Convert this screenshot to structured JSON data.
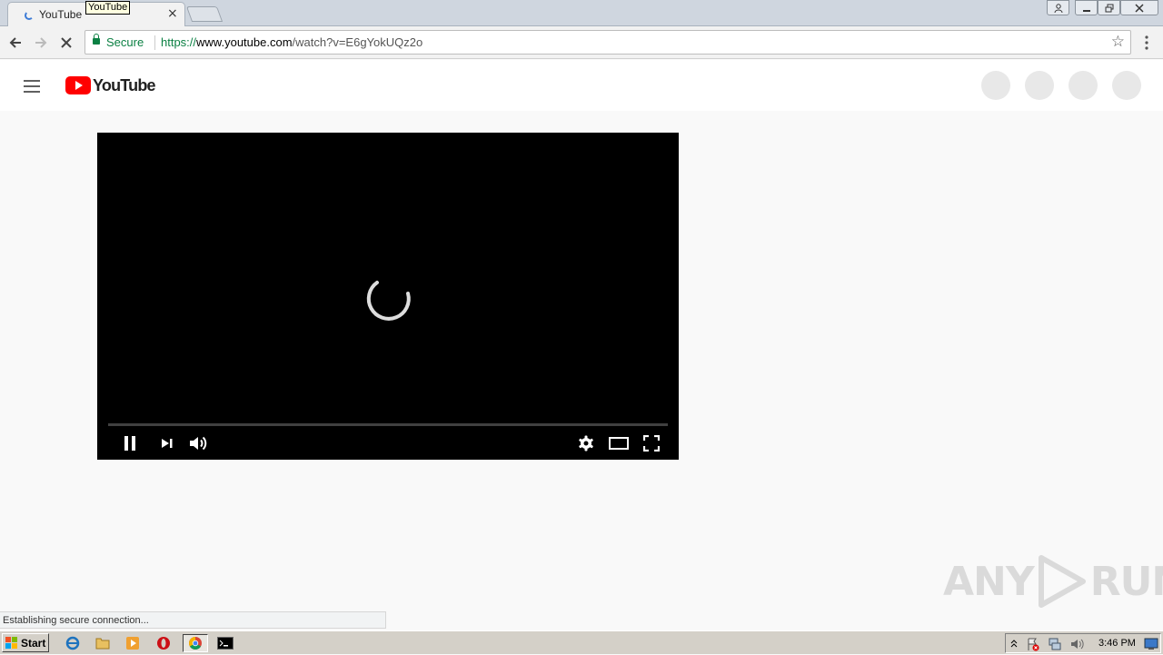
{
  "browser": {
    "tab_title": "YouTube",
    "tooltip": "YouTube",
    "tab_close": "×",
    "secure_label": "Secure",
    "url": {
      "scheme": "https://",
      "host": "www.youtube.com",
      "path": "/watch?v=E6gYokUQz2o"
    },
    "status_text": "Establishing secure connection..."
  },
  "youtube": {
    "logo_text": "YouTube",
    "brand_color": "#ff0000"
  },
  "player": {
    "state": "loading",
    "progress_fraction": 0.0
  },
  "taskbar": {
    "start_label": "Start",
    "clock": "3:46 PM"
  },
  "watermark": {
    "text_left": "ANY",
    "text_right": "RUN"
  }
}
